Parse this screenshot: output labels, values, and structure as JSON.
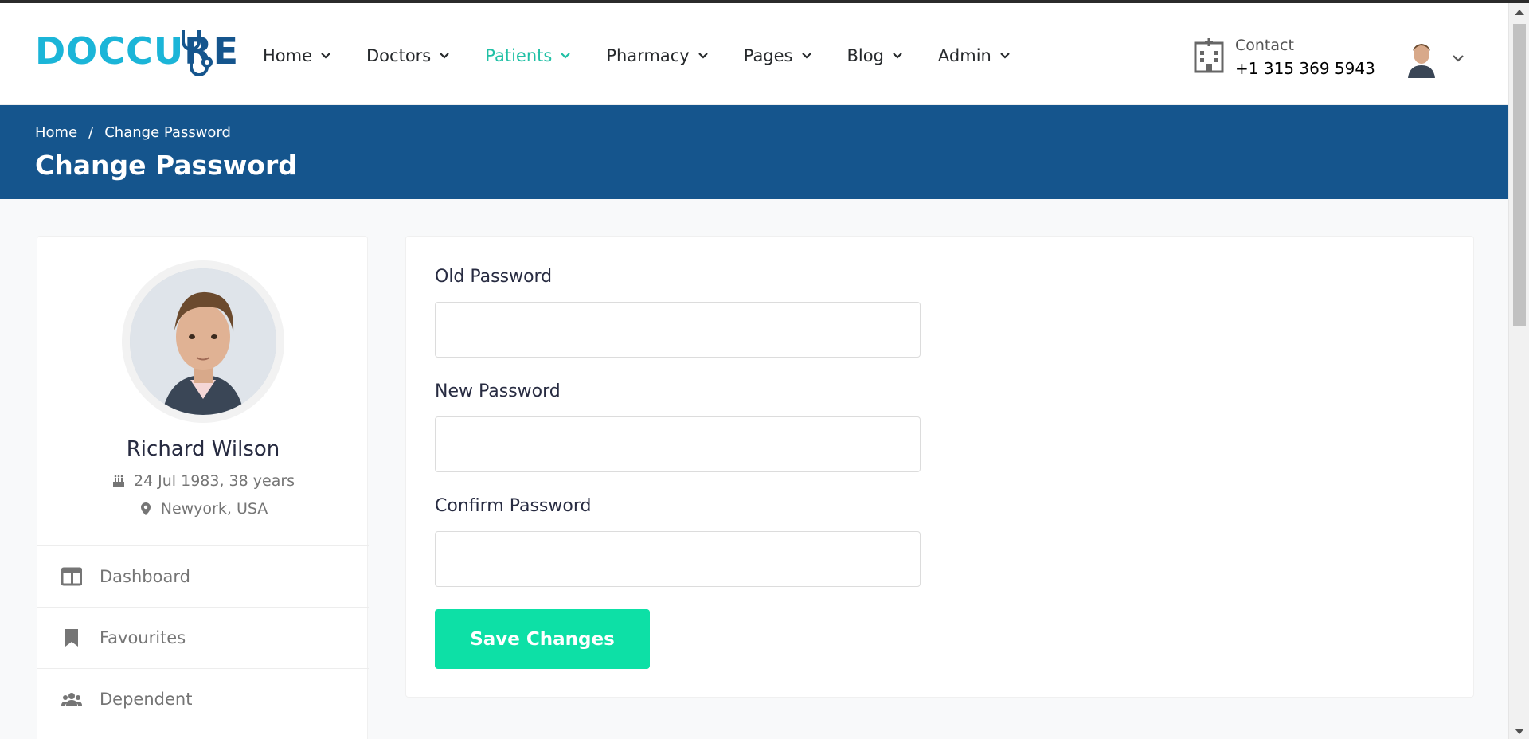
{
  "brand": {
    "logo_text_a": "DOCC",
    "logo_text_b": "U",
    "logo_text_c": "RE"
  },
  "nav": {
    "items": [
      {
        "label": "Home",
        "active": false
      },
      {
        "label": "Doctors",
        "active": false
      },
      {
        "label": "Patients",
        "active": true
      },
      {
        "label": "Pharmacy",
        "active": false
      },
      {
        "label": "Pages",
        "active": false
      },
      {
        "label": "Blog",
        "active": false
      },
      {
        "label": "Admin",
        "active": false
      }
    ]
  },
  "contact": {
    "label": "Contact",
    "phone": "+1 315 369 5943"
  },
  "breadcrumb": {
    "home": "Home",
    "separator": "/",
    "current": "Change Password"
  },
  "page": {
    "title": "Change Password"
  },
  "profile": {
    "name": "Richard Wilson",
    "dob": "24 Jul 1983, 38 years",
    "location": "Newyork, USA"
  },
  "sidebar": {
    "items": [
      {
        "label": "Dashboard",
        "icon": "columns-icon"
      },
      {
        "label": "Favourites",
        "icon": "bookmark-icon"
      },
      {
        "label": "Dependent",
        "icon": "users-icon"
      }
    ]
  },
  "form": {
    "old_password_label": "Old Password",
    "old_password_value": "",
    "new_password_label": "New Password",
    "new_password_value": "",
    "confirm_password_label": "Confirm Password",
    "confirm_password_value": "",
    "save_label": "Save Changes"
  },
  "colors": {
    "primary": "#15558d",
    "accent": "#20c0a5",
    "button": "#0de0a6",
    "logo_cyan": "#1bb5d8"
  }
}
